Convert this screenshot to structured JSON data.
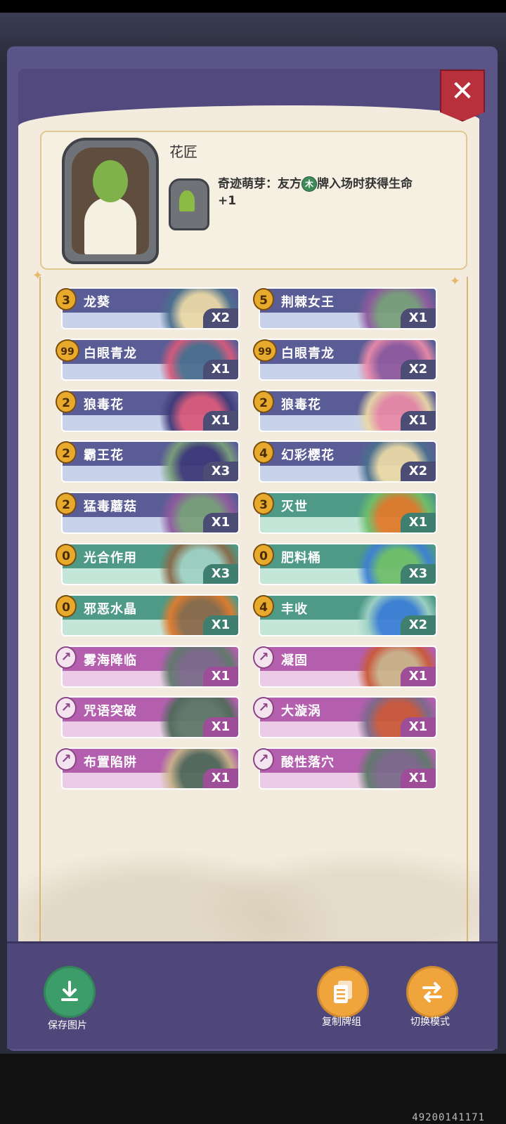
{
  "hero": {
    "name": "花匠",
    "skill_title": "奇迹萌芽：",
    "skill_pre": "友方",
    "skill_element": "木",
    "skill_post": "牌入场时获得生命",
    "skill_tail": "+1"
  },
  "close_label": "✕",
  "cards": [
    {
      "cost": "3",
      "name": "龙葵",
      "count": "X2",
      "type": "plant"
    },
    {
      "cost": "5",
      "name": "荆棘女王",
      "count": "X1",
      "type": "plant"
    },
    {
      "cost": "99",
      "name": "白眼青龙",
      "count": "X1",
      "type": "plant"
    },
    {
      "cost": "99",
      "name": "白眼青龙",
      "count": "X2",
      "type": "plant"
    },
    {
      "cost": "2",
      "name": "狼毒花",
      "count": "X1",
      "type": "plant"
    },
    {
      "cost": "2",
      "name": "狼毒花",
      "count": "X1",
      "type": "plant"
    },
    {
      "cost": "2",
      "name": "霸王花",
      "count": "X3",
      "type": "plant"
    },
    {
      "cost": "4",
      "name": "幻彩樱花",
      "count": "X2",
      "type": "plant"
    },
    {
      "cost": "2",
      "name": "猛毒蘑菇",
      "count": "X1",
      "type": "plant"
    },
    {
      "cost": "3",
      "name": "灭世",
      "count": "X1",
      "type": "spell"
    },
    {
      "cost": "0",
      "name": "光合作用",
      "count": "X3",
      "type": "spell"
    },
    {
      "cost": "0",
      "name": "肥料桶",
      "count": "X3",
      "type": "spell"
    },
    {
      "cost": "0",
      "name": "邪恶水晶",
      "count": "X1",
      "type": "spell"
    },
    {
      "cost": "4",
      "name": "丰收",
      "count": "X2",
      "type": "spell"
    },
    {
      "cost": "",
      "name": "雾海降临",
      "count": "X1",
      "type": "trap"
    },
    {
      "cost": "",
      "name": "凝固",
      "count": "X1",
      "type": "trap"
    },
    {
      "cost": "",
      "name": "咒语突破",
      "count": "X1",
      "type": "trap"
    },
    {
      "cost": "",
      "name": "大漩涡",
      "count": "X1",
      "type": "trap"
    },
    {
      "cost": "",
      "name": "布置陷阱",
      "count": "X1",
      "type": "trap"
    },
    {
      "cost": "",
      "name": "酸性落穴",
      "count": "X1",
      "type": "trap"
    }
  ],
  "footer": {
    "save_label": "保存图片",
    "copy_label": "复制牌组",
    "switch_label": "切换模式"
  },
  "watermark_id": "49200141171",
  "colors": {
    "plant_header": "#5a5d95",
    "spell_header": "#4e9a86",
    "trap_header": "#b45fae",
    "cost_gold": "#e8aa2c",
    "close_red": "#b8303c"
  }
}
